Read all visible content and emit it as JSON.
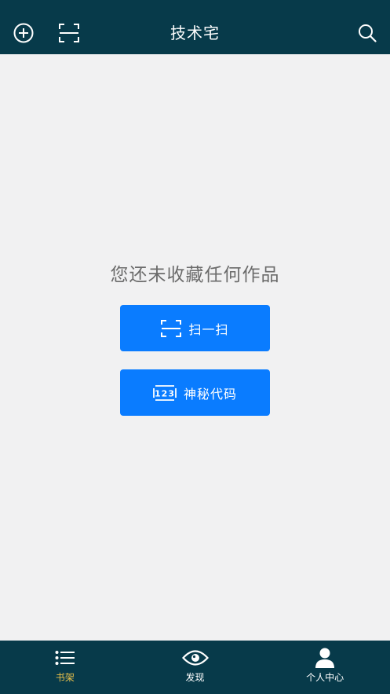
{
  "header": {
    "title": "技术宅",
    "icons": [
      "add-circle-icon",
      "scan-icon",
      "search-icon"
    ]
  },
  "main": {
    "empty_message": "您还未收藏任何作品",
    "scan_button": "扫一扫",
    "code_button": "神秘代码",
    "code_icon_text": "123"
  },
  "tabs": [
    {
      "label": "书架",
      "icon": "list-icon",
      "active": true
    },
    {
      "label": "发现",
      "icon": "eye-icon",
      "active": false
    },
    {
      "label": "个人中心",
      "icon": "person-icon",
      "active": false
    }
  ],
  "colors": {
    "bar": "#073a4a",
    "background": "#f1f1f2",
    "button": "#0a7cff",
    "active_tab": "#e8c04a"
  }
}
